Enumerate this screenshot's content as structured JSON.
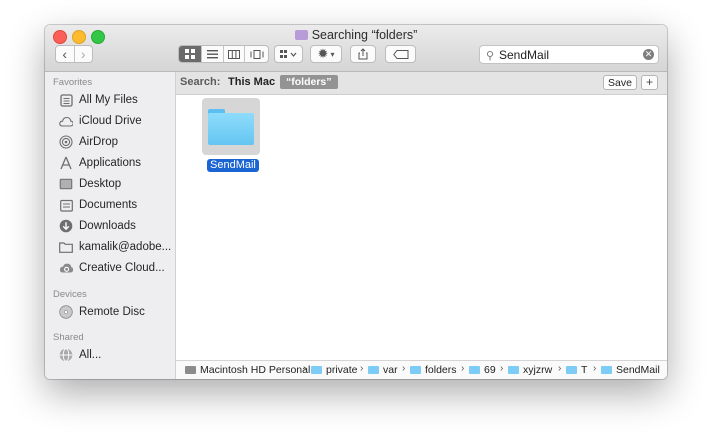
{
  "window": {
    "title": "Searching “folders”",
    "title_icon": "search-folder-icon"
  },
  "toolbar": {
    "back": "‹",
    "forward": "›",
    "views": [
      "icon-view",
      "list-view",
      "column-view",
      "cover-flow-view"
    ],
    "arrange_icon": "arrange-icon",
    "action_icon": "gear-icon",
    "share_icon": "share-icon",
    "tag_icon": "tag-icon"
  },
  "search": {
    "value": "SendMail"
  },
  "sidebar": {
    "favorites_label": "Favorites",
    "favorites": [
      {
        "label": "All My Files",
        "icon": "all-files-icon"
      },
      {
        "label": "iCloud Drive",
        "icon": "cloud-icon"
      },
      {
        "label": "AirDrop",
        "icon": "airdrop-icon"
      },
      {
        "label": "Applications",
        "icon": "applications-icon"
      },
      {
        "label": "Desktop",
        "icon": "desktop-icon"
      },
      {
        "label": "Documents",
        "icon": "documents-icon"
      },
      {
        "label": "Downloads",
        "icon": "downloads-icon"
      },
      {
        "label": "kamalik@adobe...",
        "icon": "folder-icon"
      },
      {
        "label": "Creative Cloud...",
        "icon": "creative-cloud-icon"
      }
    ],
    "devices_label": "Devices",
    "devices": [
      {
        "label": "Remote Disc",
        "icon": "disc-icon"
      }
    ],
    "shared_label": "Shared",
    "shared": [
      {
        "label": "All...",
        "icon": "network-icon"
      }
    ]
  },
  "scope": {
    "label": "Search:",
    "this_mac": "This Mac",
    "folder_token": "“folders”",
    "save": "Save",
    "add": "+"
  },
  "results": [
    {
      "name": "SendMail",
      "icon": "folder-icon",
      "selected": true
    }
  ],
  "pathbar": [
    "Macintosh HD Personal",
    "private",
    "var",
    "folders",
    "69",
    "xyjzrw",
    "T",
    "SendMail"
  ],
  "colors": {
    "selection": "#1a64d4",
    "folder": "#64c5f2",
    "close": "#fc5f57",
    "minimize": "#fdbc2e",
    "zoom": "#33c748"
  }
}
